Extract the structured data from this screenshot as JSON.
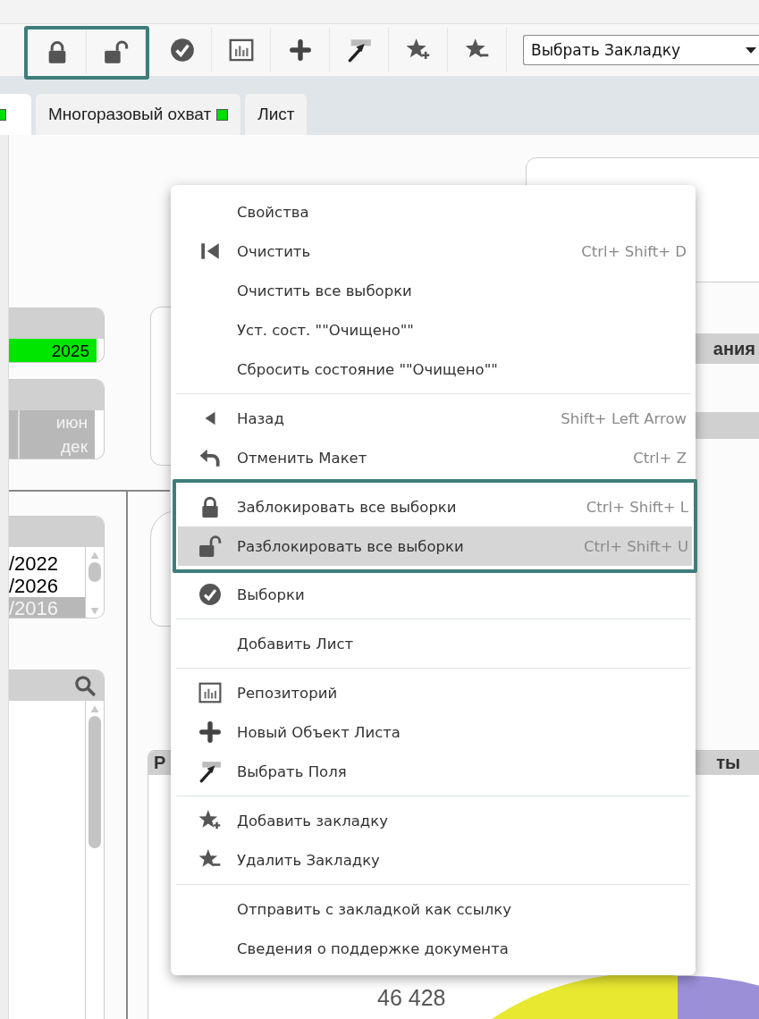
{
  "toolbar": {
    "bookmark_select": {
      "value": "Выбрать Закладку"
    }
  },
  "tabs": [
    {
      "color": "#00dd00",
      "selected": true
    },
    {
      "label": "Многоразовый охват",
      "color": "#00dd00",
      "selected": false
    },
    {
      "label": "Лист",
      "selected": false
    }
  ],
  "sheet": {
    "year_list": {
      "items": [
        {
          "label": "2025",
          "selected": true,
          "excluded": false
        }
      ]
    },
    "month_list": {
      "items": [
        {
          "label": "июн",
          "selected": false,
          "excluded": true
        },
        {
          "label": "дек",
          "selected": false,
          "excluded": true
        }
      ]
    },
    "date_list": {
      "items": [
        {
          "label": "/2022",
          "selected": false,
          "excluded": false
        },
        {
          "label": "/2026",
          "selected": false,
          "excluded": false
        },
        {
          "label": "/2016",
          "selected": false,
          "excluded": true
        }
      ]
    },
    "right_panel": {
      "title_fragment": "ания"
    },
    "chart_panel": {
      "title_start": "Р",
      "title_end": "ты",
      "value_label": "46 428"
    }
  },
  "context_menu": {
    "sections": [
      {
        "highlighted": false,
        "items": [
          {
            "label": "Свойства",
            "selected": false
          },
          {
            "label": "Очистить",
            "shortcut": "Ctrl+ Shift+ D",
            "selected": false
          },
          {
            "label": "Очистить все выборки",
            "selected": false
          },
          {
            "label": "Уст. сост. \"\"Очищено\"\"",
            "selected": false
          },
          {
            "label": "Сбросить состояние \"\"Очищено\"\"",
            "selected": false
          }
        ]
      },
      {
        "highlighted": false,
        "items": [
          {
            "label": "Назад",
            "shortcut": "Shift+ Left Arrow",
            "selected": false
          },
          {
            "label": "Отменить Макет",
            "shortcut": "Ctrl+ Z",
            "selected": false
          }
        ]
      },
      {
        "highlighted": true,
        "items": [
          {
            "label": "Заблокировать все выборки",
            "shortcut": "Ctrl+ Shift+ L",
            "selected": false
          },
          {
            "label": "Разблокировать все выборки",
            "shortcut": "Ctrl+ Shift+ U",
            "selected": true
          }
        ]
      },
      {
        "highlighted": false,
        "items": [
          {
            "label": "Выборки",
            "selected": false
          }
        ]
      },
      {
        "highlighted": false,
        "items": [
          {
            "label": "Добавить Лист",
            "selected": false
          }
        ]
      },
      {
        "highlighted": false,
        "items": [
          {
            "label": "Репозиторий",
            "selected": false
          },
          {
            "label": "Новый Объект Листа",
            "selected": false
          },
          {
            "label": "Выбрать Поля",
            "selected": false
          }
        ]
      },
      {
        "highlighted": false,
        "items": [
          {
            "label": "Добавить закладку",
            "selected": false
          },
          {
            "label": "Удалить Закладку",
            "selected": false
          }
        ]
      },
      {
        "highlighted": false,
        "items": [
          {
            "label": "Отправить с закладкой как ссылку",
            "selected": false
          },
          {
            "label": "Сведения о поддержке документа",
            "selected": false
          }
        ]
      }
    ]
  }
}
